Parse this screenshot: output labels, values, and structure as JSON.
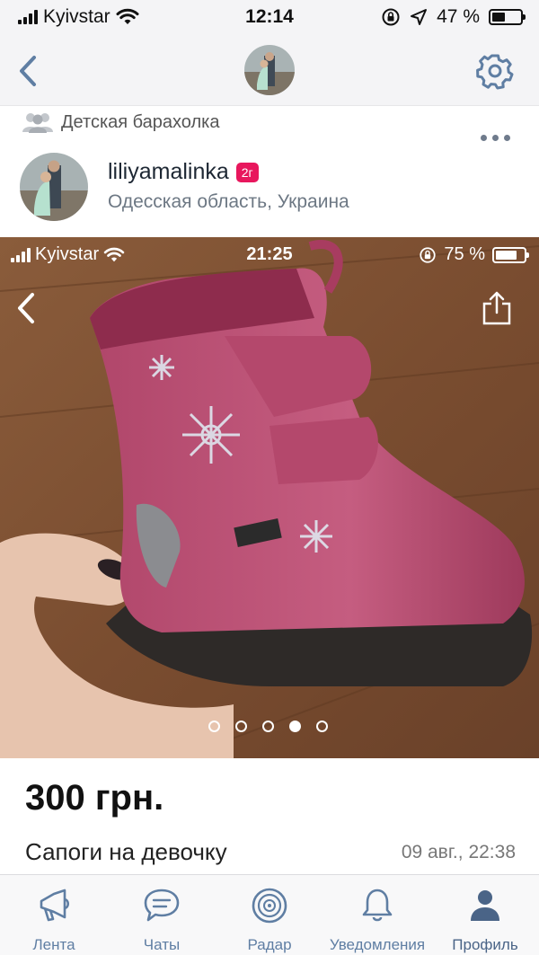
{
  "status_bar": {
    "carrier": "Kyivstar",
    "time": "12:14",
    "battery": "47 %",
    "battery_level": 0.47
  },
  "nav": {
    "back_icon": "chevron-left-icon",
    "settings_icon": "gear-icon"
  },
  "group": {
    "name": "Детская барахолка",
    "icon": "group-people-icon"
  },
  "seller": {
    "name": "liliyamalinka",
    "age_badge": "2г",
    "location": "Одесская область, Украина"
  },
  "photo": {
    "inner_status": {
      "carrier": "Kyivstar",
      "time": "21:25",
      "battery": "75 %",
      "battery_level": 0.75
    },
    "pager": {
      "count": 5,
      "active_index": 3
    }
  },
  "listing": {
    "price": "300 грн.",
    "title": "Сапоги на девочку",
    "date": "09 авг., 22:38"
  },
  "tabs": [
    {
      "label": "Лента",
      "icon": "megaphone-icon"
    },
    {
      "label": "Чаты",
      "icon": "chat-icon"
    },
    {
      "label": "Радар",
      "icon": "radar-icon"
    },
    {
      "label": "Уведомления",
      "icon": "bell-icon"
    },
    {
      "label": "Профиль",
      "icon": "person-icon",
      "active": true
    }
  ],
  "colors": {
    "accent": "#5f7ea3",
    "badge": "#e8175d",
    "bar_bg": "#f4f4f6"
  }
}
